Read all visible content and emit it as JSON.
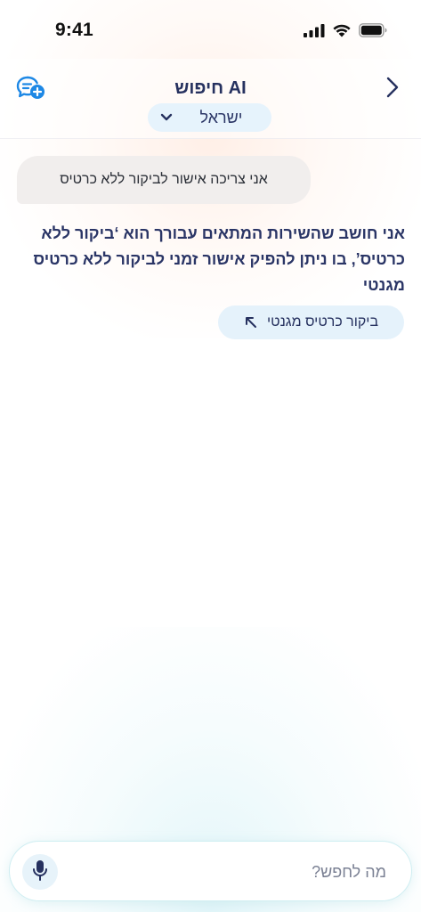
{
  "status_bar": {
    "time": "9:41",
    "icons": [
      "cellular-signal-icon",
      "wifi-icon",
      "battery-icon"
    ]
  },
  "header": {
    "title": "חיפוש AI",
    "country": "ישראל",
    "new_chat_icon": "chat-plus-icon",
    "back_icon": "chevron-right-icon",
    "dropdown_icon": "chevron-down-icon"
  },
  "conversation": {
    "user_message": "אני צריכה אישור לביקור ללא כרטיס",
    "ai_answer": "אני חושב שהשירות המתאים עבורך הוא ‘ביקור ללא כרטיס’, בו ניתן להפיק אישור זמני לביקור ללא כרטיס מגנטי",
    "suggestion_chip": "ביקור כרטיס מגנטי",
    "suggestion_icon": "arrow-up-left-icon"
  },
  "input": {
    "placeholder": "מה לחפש?",
    "value": "",
    "mic_icon": "microphone-icon"
  },
  "colors": {
    "primary_text": "#2a3566",
    "accent_blue": "#1e88e5",
    "chip_bg": "#e5f2fb",
    "user_bubble_bg": "#f1eeed"
  }
}
